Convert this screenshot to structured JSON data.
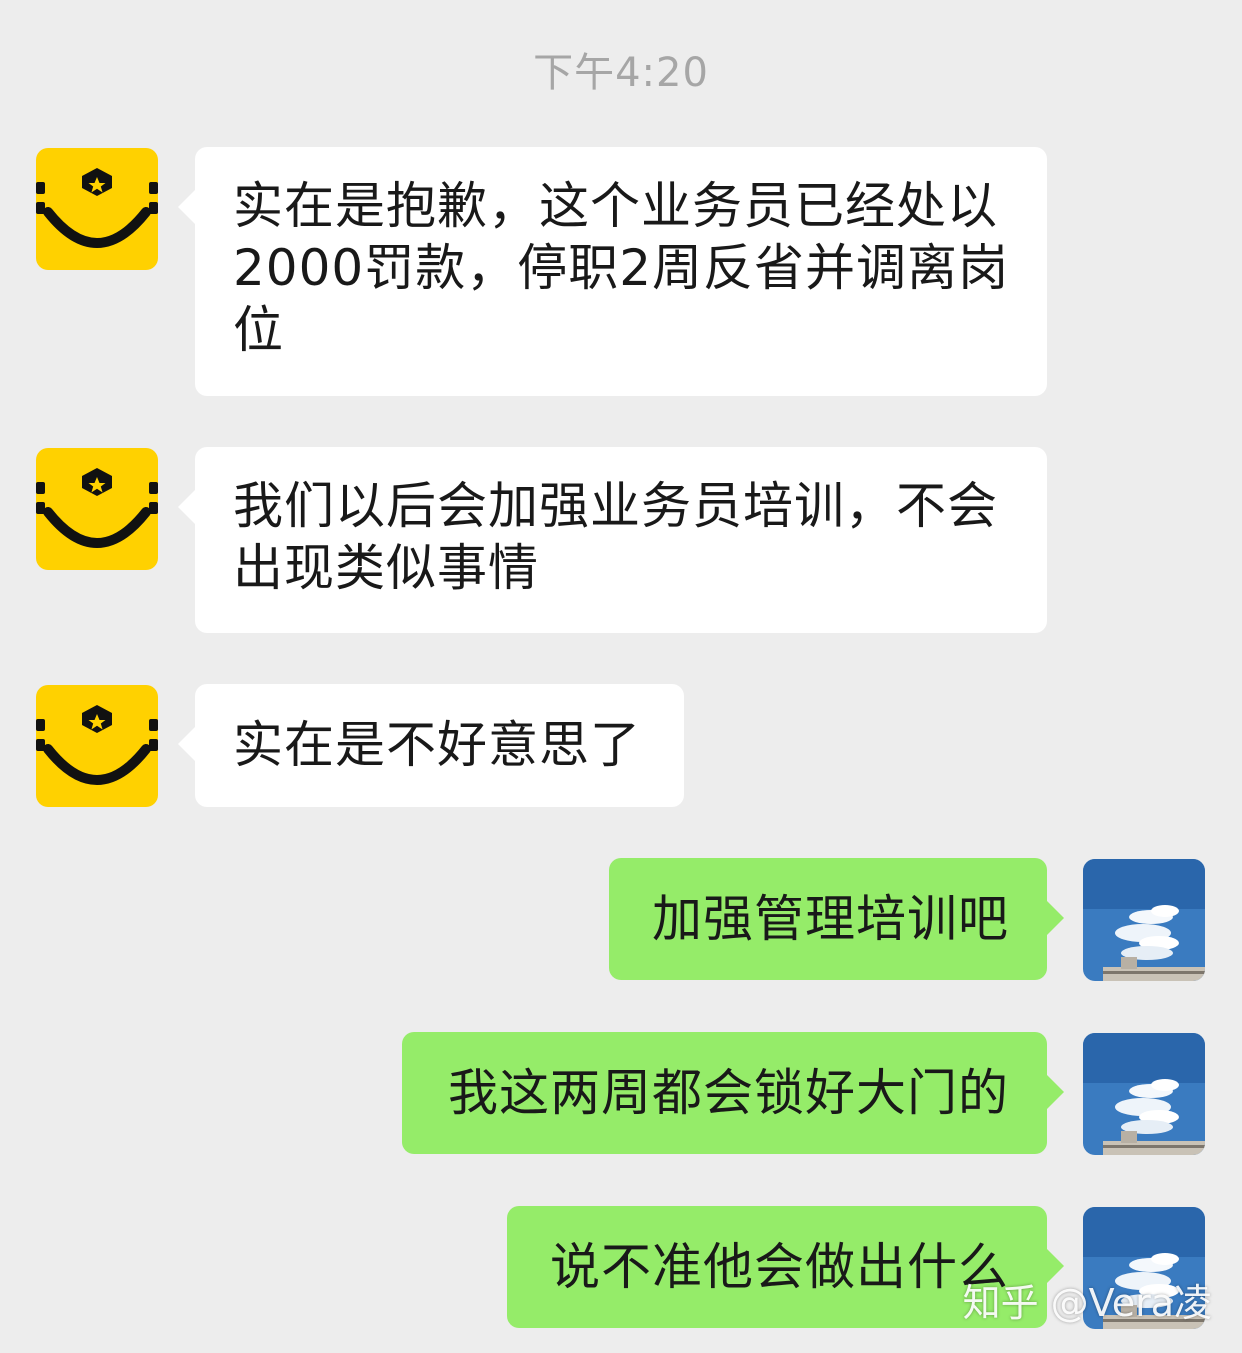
{
  "chat": {
    "timestamp": "下午4:20",
    "colors": {
      "background": "#ededed",
      "incoming_bubble": "#ffffff",
      "outgoing_bubble": "#95ec69",
      "brand_yellow": "#ffd100"
    },
    "messages": [
      {
        "sender": "merchant",
        "avatar": "smiley-logo-icon",
        "text": "实在是抱歉，这个业务员已经处以2000罚款，停职2周反省并调离岗位"
      },
      {
        "sender": "merchant",
        "avatar": "smiley-logo-icon",
        "text": "我们以后会加强业务员培训，不会出现类似事情"
      },
      {
        "sender": "merchant",
        "avatar": "smiley-logo-icon",
        "text": "实在是不好意思了"
      },
      {
        "sender": "me",
        "avatar": "sky-photo-icon",
        "text": "加强管理培训吧"
      },
      {
        "sender": "me",
        "avatar": "sky-photo-icon",
        "text": "我这两周都会锁好大门的"
      },
      {
        "sender": "me",
        "avatar": "sky-photo-icon",
        "text": "说不准他会做出什么"
      }
    ]
  },
  "watermark": "知乎 @Vera凌"
}
